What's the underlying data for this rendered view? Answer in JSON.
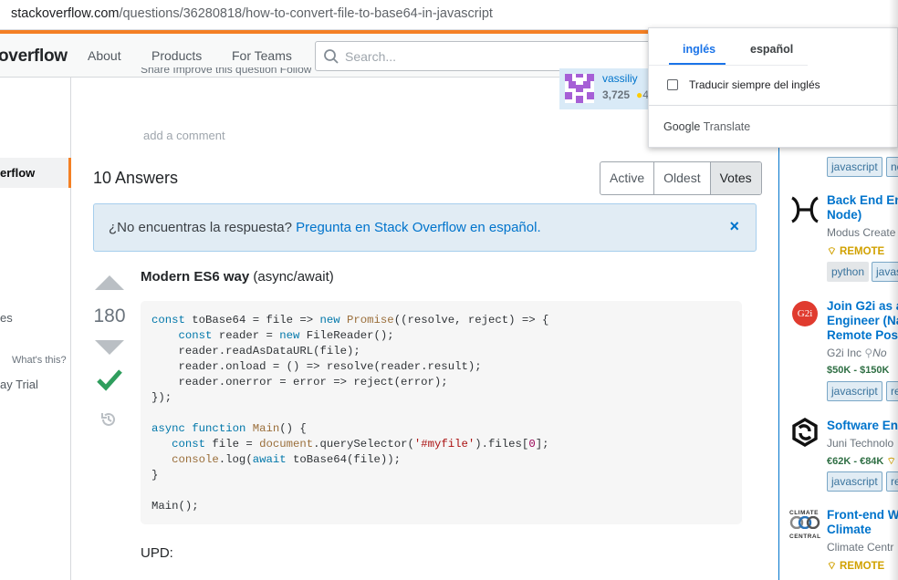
{
  "browser": {
    "url_host": "stackoverflow.com",
    "url_path": "/questions/36280818/how-to-convert-file-to-base64-in-javascript"
  },
  "header": {
    "logo_text": "overflow",
    "nav": [
      "About",
      "Products",
      "For Teams"
    ],
    "search_placeholder": "Search..."
  },
  "leftnav": {
    "active_item": "erflow",
    "item_es": "es",
    "whats_this": "What's this?",
    "trial": "ay Trial"
  },
  "question": {
    "actions_partial": "Share  Improve this question  Follow",
    "user_name": "vassiliy",
    "user_rep": "3,725",
    "user_badge_partial": "4",
    "add_comment": "add a comment"
  },
  "answers": {
    "count_label": "10 Answers",
    "sort_tabs": [
      "Active",
      "Oldest",
      "Votes"
    ],
    "sort_selected": "Votes"
  },
  "notice": {
    "text": "¿No encuentras la respuesta? ",
    "link": "Pregunta en Stack Overflow en español.",
    "close": "×"
  },
  "answer": {
    "votes": "180",
    "title_bold": "Modern ES6 way",
    "title_rest": " (async/await)",
    "upd": "UPD:",
    "code_lines": [
      "const toBase64 = file => new Promise((resolve, reject) => {",
      "    const reader = new FileReader();",
      "    reader.readAsDataURL(file);",
      "    reader.onload = () => resolve(reader.result);",
      "    reader.onerror = error => reject(error);",
      "});",
      "",
      "async function Main() {",
      "   const file = document.querySelector('#myfile').files[0];",
      "   console.log(await toBase64(file));",
      "}",
      "",
      "Main();"
    ]
  },
  "jobs": {
    "top_remote_partial": "REMOTE",
    "top_tags": [
      "javascript",
      "no"
    ],
    "items": [
      {
        "title1": "Back End En",
        "title2": "Node)",
        "company": "Modus Create",
        "remote": "REMOTE",
        "tags": [
          "python",
          "javas"
        ]
      },
      {
        "title1": "Join G2i as a",
        "title2": "Engineer (Na",
        "title3": "Remote Posit",
        "company": "G2i Inc",
        "location": "No",
        "salary": "$50K - $150K",
        "tags": [
          "javascript",
          "re"
        ]
      },
      {
        "title1": "Software Eng",
        "company": "Juni Technolo",
        "salary": "€62K - €84K",
        "tags": [
          "javascript",
          "re"
        ]
      },
      {
        "title1": "Front-end We",
        "title2": "Climate",
        "company": "Climate Centr",
        "remote": "REMOTE",
        "logo_text1": "CLIMATE",
        "logo_text2": "CENTRAL"
      }
    ]
  },
  "translate": {
    "tab_source": "inglés",
    "tab_target": "español",
    "always_label": "Traducir siempre del inglés",
    "brand_google": "Google",
    "brand_translate": "Translate"
  },
  "colors": {
    "accent_orange": "#f48024",
    "link_blue": "#0074cc",
    "accepted_green": "#2f9e5d"
  }
}
